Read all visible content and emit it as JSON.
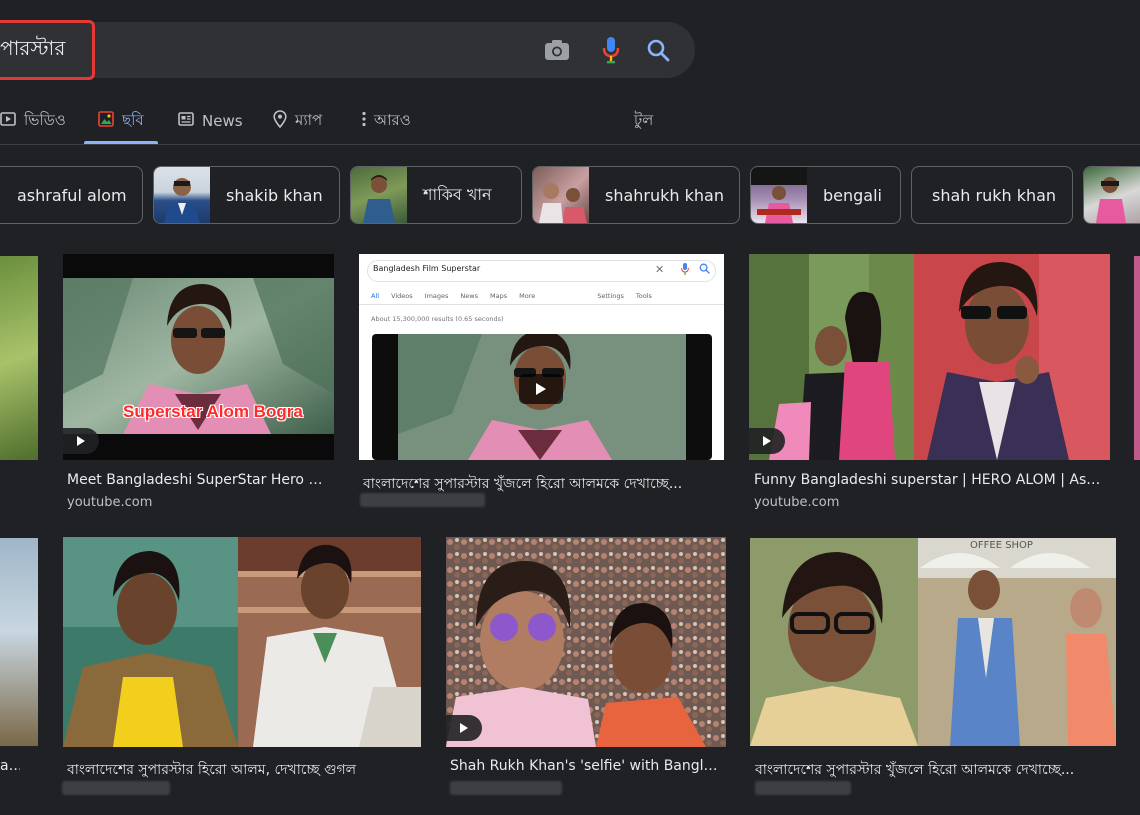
{
  "search": {
    "query": "পারস্টার"
  },
  "tabs": [
    {
      "label": "ভিডিও",
      "icon": "video-icon"
    },
    {
      "label": "ছবি",
      "icon": "images-icon",
      "active": true
    },
    {
      "label": "News",
      "icon": "news-icon"
    },
    {
      "label": "ম্যাপ",
      "icon": "map-pin-icon"
    },
    {
      "label": "আরও",
      "icon": "more-dots-icon"
    },
    {
      "label": "টুল"
    }
  ],
  "chips": [
    {
      "label": "ashraful alom"
    },
    {
      "label": "shakib khan"
    },
    {
      "label": "শাকিব খান"
    },
    {
      "label": "shahrukh khan"
    },
    {
      "label": "bengali"
    },
    {
      "label": "shah rukh khan"
    }
  ],
  "results": [
    {
      "title": "Meet Bangladeshi SuperStar Hero Al...",
      "source": "youtube.com",
      "overlay_text": "Superstar Alom Bogra"
    },
    {
      "title": "বাংলাদেশের সুপারস্টার খুঁজলে হিরো আলমকে দেখাচ্ছে...",
      "source": "",
      "inner_search_query": "Bangladesh Film Superstar",
      "inner_tabs": [
        "All",
        "Videos",
        "Images",
        "News",
        "Maps",
        "More",
        "Settings",
        "Tools"
      ],
      "inner_results_count": "About 15,300,000 results (0.65 seconds)"
    },
    {
      "title": "Funny Bangladeshi superstar | HERO ALOM | Ashr...",
      "source": "youtube.com"
    },
    {
      "title": "বাংলাদেশের সুপারস্টার হিরো আলম, দেখাচ্ছে গুগল",
      "source": ""
    },
    {
      "title": "Shah Rukh Khan's 'selfie' with Banglad...",
      "source": ""
    },
    {
      "title": "বাংলাদেশের সুপারস্টার খুঁজলে হিরো আলমকে দেখাচ্ছে...",
      "source": "",
      "sign_text": "OFFEE SHOP"
    }
  ],
  "edge_results": [
    {
      "title": "a..."
    }
  ],
  "colors": {
    "background": "#202124",
    "accent": "#8ab4f8",
    "highlight": "#e53935"
  }
}
